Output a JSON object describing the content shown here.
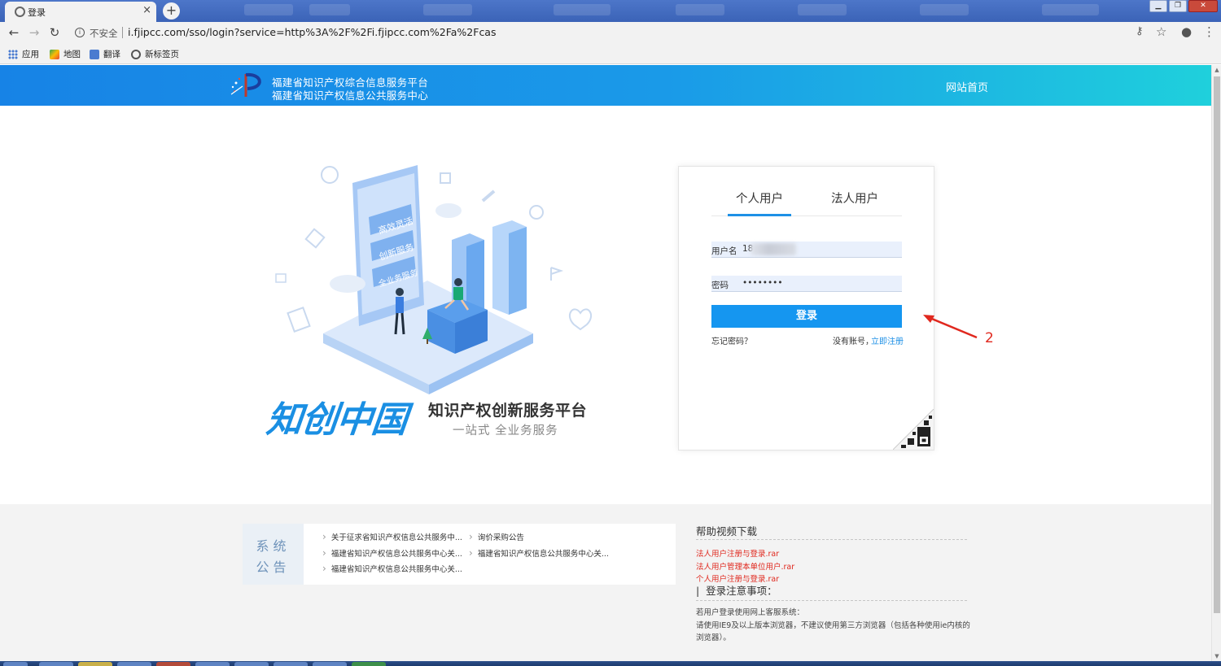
{
  "browser": {
    "tab_title": "登录",
    "tab_close": "×",
    "new_tab": "+",
    "security_label": "不安全",
    "url": "i.fjipcc.com/sso/login?service=http%3A%2F%2Fi.fjipcc.com%2Fa%2Fcas",
    "bookmarks": [
      "应用",
      "地图",
      "翻译",
      "新标签页"
    ]
  },
  "header": {
    "title_line1": "福建省知识产权综合信息服务平台",
    "title_line2": "福建省知识产权信息公共服务中心",
    "home_link": "网站首页"
  },
  "hero": {
    "brand": "知创中国",
    "subtitle": "知识产权创新服务平台",
    "tagline": "一站式  全业务服务",
    "phone_labels": [
      "高效灵活",
      "创新服务",
      "全业务服务"
    ]
  },
  "login": {
    "tabs": [
      "个人用户",
      "法人用户"
    ],
    "active_tab": "个人用户",
    "username_label": "用户名",
    "username_value": "18",
    "password_label": "密码",
    "password_value": "••••••••",
    "submit_label": "登录",
    "forgot_label": "忘记密码？",
    "no_account_label": "没有账号，",
    "register_label": "立即注册"
  },
  "annotation": {
    "number": "2",
    "color": "#e0281e"
  },
  "notices": {
    "label_line1": "系统",
    "label_line2": "公告",
    "items": [
      "关于征求省知识产权信息公共服务中...",
      "询价采购公告",
      "福建省知识产权信息公共服务中心关...",
      "福建省知识产权信息公共服务中心关...",
      "福建省知识产权信息公共服务中心关..."
    ]
  },
  "help": {
    "title": "帮助视频下载",
    "links": [
      "法人用户注册与登录.rar",
      "法人用户管理本单位用户.rar",
      "个人用户注册与登录.rar"
    ],
    "notes_title": "登录注意事项：",
    "notes_line1": "若用户登录使用网上客服系统：",
    "notes_line2": "请使用IE9及以上版本浏览器，不建议使用第三方浏览器（包括各种使用ie内核的浏览器）。"
  },
  "colors": {
    "header_gradient_start": "#1783e6",
    "header_gradient_end": "#1fd0dc",
    "primary_button": "#1596f0",
    "link_red": "#e0281e",
    "tab_active": "#1e90e6"
  }
}
